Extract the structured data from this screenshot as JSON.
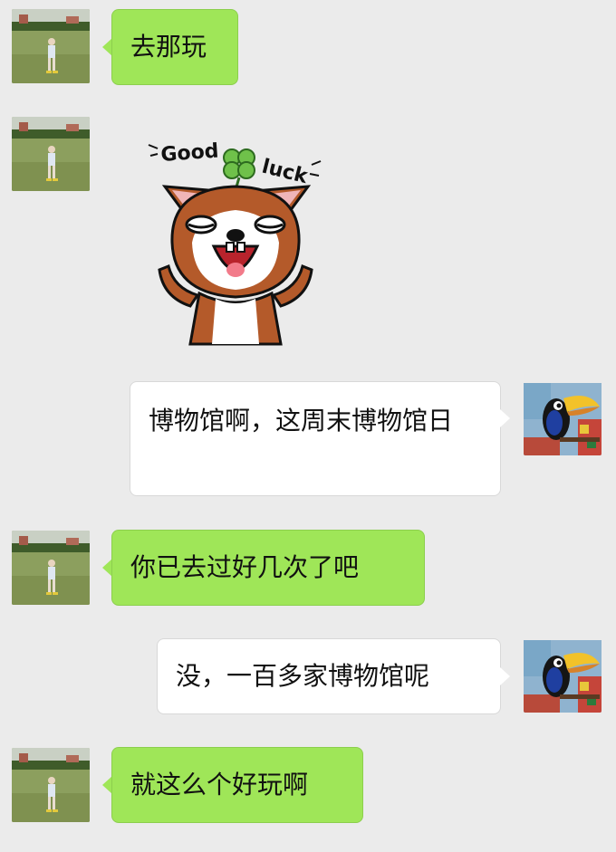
{
  "chat": {
    "messages": [
      {
        "sender": "friend",
        "type": "text",
        "text": "去那玩"
      },
      {
        "sender": "friend",
        "type": "sticker",
        "sticker_text": "Good luck"
      },
      {
        "sender": "me",
        "type": "text",
        "text": "博物馆啊，这周末博物馆日"
      },
      {
        "sender": "friend",
        "type": "text",
        "text": "你已去过好几次了吧"
      },
      {
        "sender": "me",
        "type": "text",
        "text": "没，一百多家博物馆呢"
      },
      {
        "sender": "friend",
        "type": "text",
        "text": "就这么个好玩啊"
      }
    ]
  },
  "colors": {
    "background": "#ebebeb",
    "incoming_bubble": "#9fe658",
    "outgoing_bubble": "#ffffff"
  },
  "icons": {
    "friend_avatar": "child-on-lawn-photo",
    "my_avatar": "toucan-mosaic-picture",
    "sticker": "good-luck-hamster-sticker"
  }
}
